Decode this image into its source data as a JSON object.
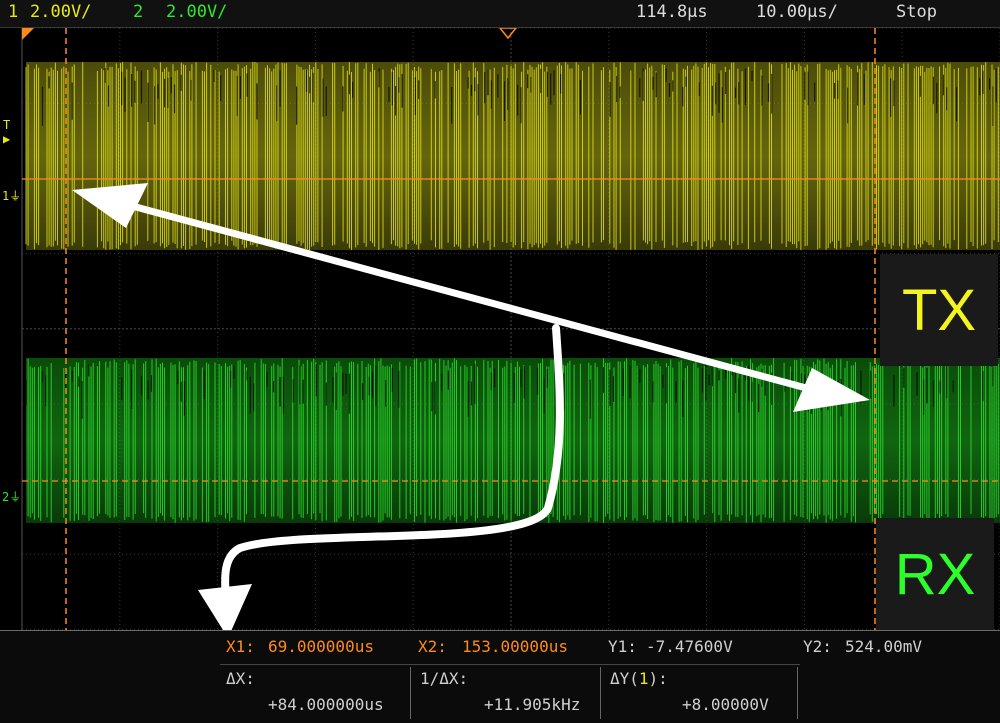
{
  "topbar": {
    "ch1_num": "1",
    "ch1_scale": "2.00V/",
    "ch2_num": "2",
    "ch2_scale": "2.00V/",
    "time_delay": "114.8µs",
    "time_scale": "10.00µs/",
    "run_state": "Stop"
  },
  "markers": {
    "trigger": "T",
    "ch1_ground": "1",
    "ch2_ground": "2"
  },
  "labels": {
    "tx": "TX",
    "rx": "RX"
  },
  "measurements": {
    "x1_label": "X1:",
    "x1_value": "69.000000us",
    "x2_label": "X2:",
    "x2_value": "153.00000us",
    "y1_label": "Y1:",
    "y1_value": "-7.47600V",
    "y2_label": "Y2:",
    "y2_value": "524.00mV",
    "dx_label": "ΔX:",
    "dx_value": "+84.000000us",
    "inv_dx_label": "1/ΔX:",
    "inv_dx_value": "+11.905kHz",
    "dy_label_prefix": "ΔY(",
    "dy_channel": "1",
    "dy_label_suffix": "):",
    "dy_value": "+8.00000V"
  },
  "colors": {
    "ch1": "#e8e817",
    "ch2": "#2ee82e",
    "cursor": "#ff8a1c",
    "arrows": "#ffffff"
  }
}
